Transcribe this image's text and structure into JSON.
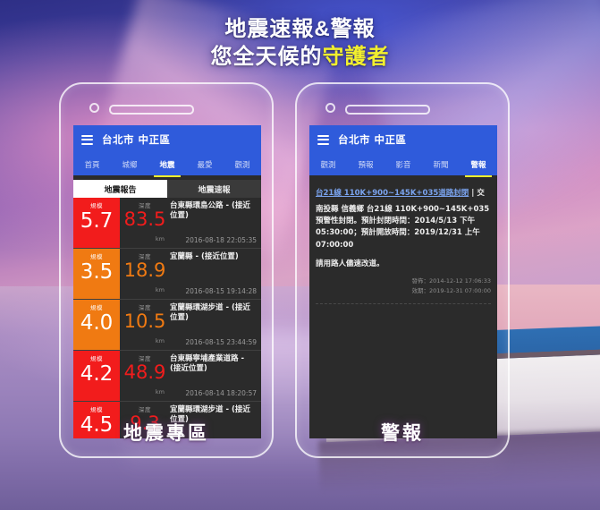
{
  "headline": {
    "line1": "地震速報&警報",
    "line2_prefix": "您全天候的",
    "line2_highlight": "守護者",
    "highlight_color": "#f2ef2e"
  },
  "phones": {
    "left": {
      "caption": "地震專區",
      "appbar": {
        "menu_icon": "hamburger-icon",
        "title": "台北市 中正區"
      },
      "tabs": [
        {
          "label": "首頁",
          "active": false
        },
        {
          "label": "城鄉",
          "active": false
        },
        {
          "label": "地震",
          "active": true
        },
        {
          "label": "最愛",
          "active": false
        },
        {
          "label": "觀測",
          "active": false
        }
      ],
      "segments": [
        {
          "label": "地震報告",
          "active": true
        },
        {
          "label": "地震速報",
          "active": false
        }
      ],
      "list_labels": {
        "magnitude": "規模",
        "depth": "深度",
        "unit": "km"
      },
      "rows": [
        {
          "magnitude": "5.7",
          "depth": "83.5",
          "place": "台東縣環島公路 - (接近位置)",
          "time": "2016-08-18 22:05:35",
          "color": "#f21c1c"
        },
        {
          "magnitude": "3.5",
          "depth": "18.9",
          "place": "宜蘭縣 - (接近位置)",
          "time": "2016-08-15 19:14:28",
          "color": "#f07a12"
        },
        {
          "magnitude": "4.0",
          "depth": "10.5",
          "place": "宜蘭縣環湖步道 - (接近位置)",
          "time": "2016-08-15 23:44:59",
          "color": "#f07a12"
        },
        {
          "magnitude": "4.2",
          "depth": "48.9",
          "place": "台東縣寧埔產業道路 - (接近位置)",
          "time": "2016-08-14 18:20:57",
          "color": "#f21c1c"
        },
        {
          "magnitude": "4.5",
          "depth": "9.3",
          "place": "宜蘭縣環湖步道 - (接近位置)",
          "time": "",
          "color": "#f21c1c"
        }
      ]
    },
    "right": {
      "caption": "警報",
      "appbar": {
        "menu_icon": "hamburger-icon",
        "title": "台北市 中正區"
      },
      "tabs": [
        {
          "label": "觀測",
          "active": false
        },
        {
          "label": "預報",
          "active": false
        },
        {
          "label": "影音",
          "active": false
        },
        {
          "label": "新聞",
          "active": false
        },
        {
          "label": "警報",
          "active": true
        }
      ],
      "alert": {
        "link_text": "台21線 110K+900~145K+035道路封閉",
        "link_tail": " | 交",
        "body": "南投縣 信義鄉 台21線 110K+900~145K+035 預警性封閉。預計封閉時間：2014/5/13 下午 05:30:00；預計開放時間：2019/12/31 上午 07:00:00",
        "note": "請用路人儘速改道。",
        "issued_label": "發佈",
        "issued_value": "2014-12-12 17:06:33",
        "expiry_label": "效期",
        "expiry_value": "2019-12-31 07:00:00"
      }
    }
  }
}
